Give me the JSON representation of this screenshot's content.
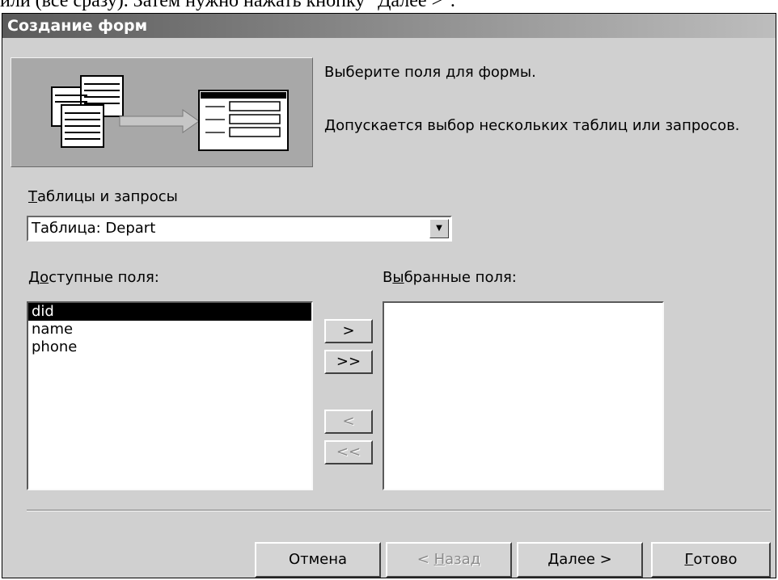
{
  "document": {
    "text": "или (все сразу). Затем нужно нажать кнопку \"Далее >\"."
  },
  "window": {
    "title": "Создание форм"
  },
  "intro": {
    "line1": "Выберите поля для формы.",
    "line2": "Допускается выбор нескольких таблиц или запросов."
  },
  "tables": {
    "label_accel": "Т",
    "label_rest": "аблицы и запросы",
    "value": "Таблица: Depart"
  },
  "available": {
    "label_pre": "Д",
    "label_accel": "о",
    "label_post": "ступные поля:",
    "items": [
      "did",
      "name",
      "phone"
    ],
    "selected_index": 0
  },
  "selected": {
    "label_pre": "В",
    "label_accel": "ы",
    "label_post": "бранные поля:",
    "items": []
  },
  "move_buttons": {
    "add": ">",
    "add_all": ">>",
    "remove": "<",
    "remove_all": "<<"
  },
  "footer": {
    "cancel": "Отмена",
    "back_pre": "< ",
    "back_accel": "Н",
    "back_post": "азад",
    "next_accel": "Д",
    "next_post": "алее >",
    "finish_accel": "Г",
    "finish_post": "отово"
  }
}
